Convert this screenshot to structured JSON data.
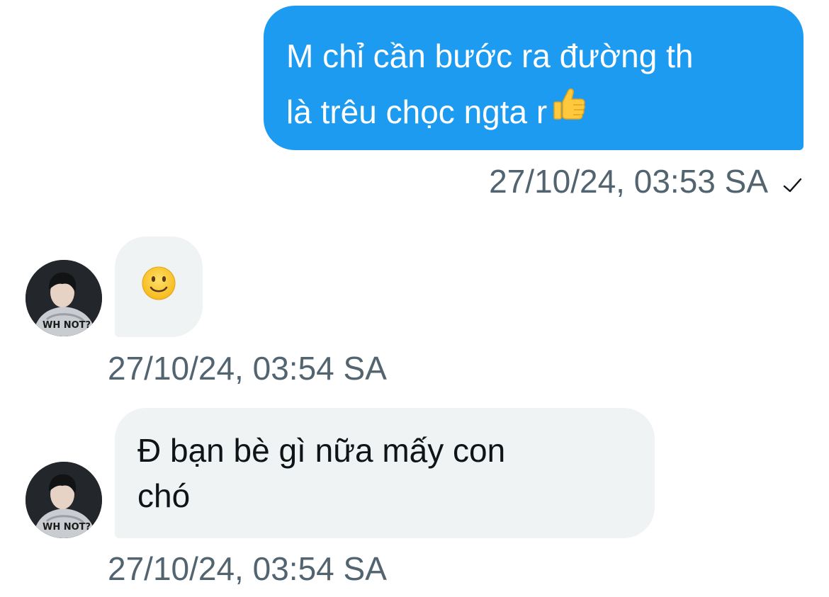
{
  "messages": [
    {
      "direction": "outgoing",
      "lines": [
        "M chỉ cần bước ra đường th",
        "là trêu chọc ngta r"
      ],
      "emoji": "thumbs-up",
      "timestamp": "27/10/24, 03:53 SA",
      "status_icon": "checkmark-icon"
    },
    {
      "direction": "incoming",
      "emoji": "slightly-smiling-face",
      "timestamp": "27/10/24, 03:54 SA"
    },
    {
      "direction": "incoming",
      "lines": [
        "Đ bạn bè gì nữa mấy con",
        "chó"
      ],
      "timestamp": "27/10/24, 03:54 SA"
    }
  ],
  "colors": {
    "outgoing_bubble": "#1d9bf0",
    "incoming_bubble": "#eff3f4",
    "timestamp_text": "#536471",
    "message_text": "#0f1419"
  }
}
